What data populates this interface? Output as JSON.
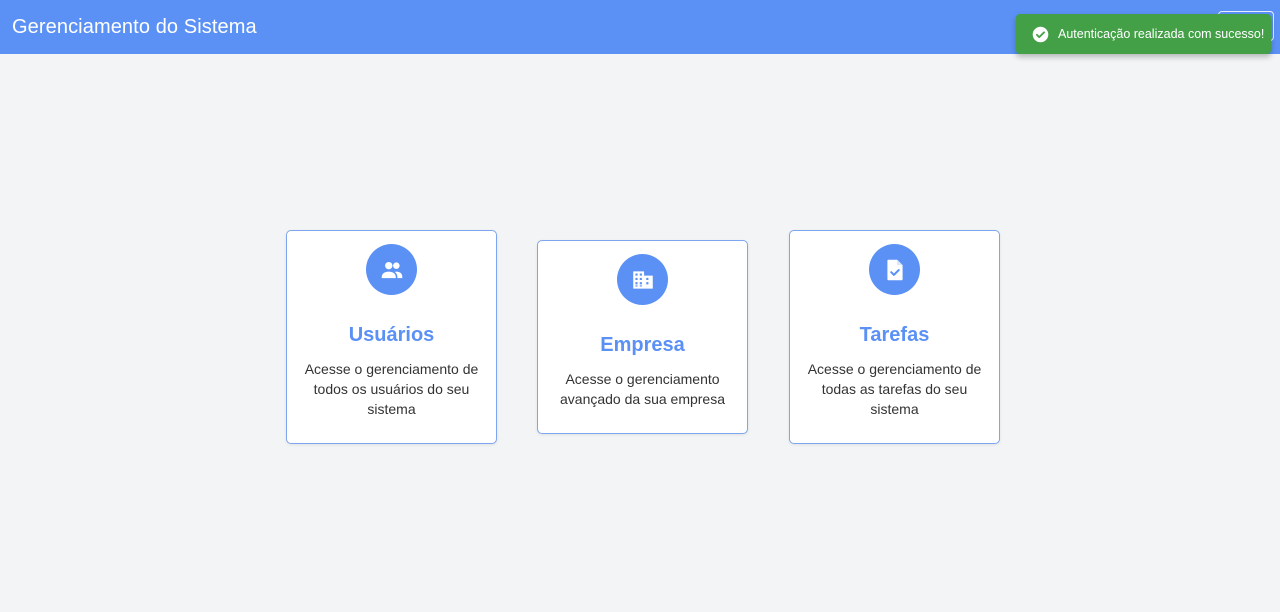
{
  "appbar": {
    "title": "Gerenciamento do Sistema"
  },
  "toast": {
    "message": "Autenticação realizada com sucesso!",
    "icon": "check-circle-icon",
    "color": "#43a047"
  },
  "cards": [
    {
      "title": "Usuários",
      "description": "Acesse o gerenciamento de todos os usuários do seu sistema",
      "icon": "users-icon"
    },
    {
      "title": "Empresa",
      "description": "Acesse o gerenciamento avançado da sua empresa",
      "icon": "building-icon"
    },
    {
      "title": "Tarefas",
      "description": "Acesse o gerenciamento de todas as tarefas do seu sistema",
      "icon": "task-document-icon"
    }
  ],
  "colors": {
    "primary": "#5b91f5",
    "background": "#f3f4f6",
    "success": "#43a047"
  }
}
